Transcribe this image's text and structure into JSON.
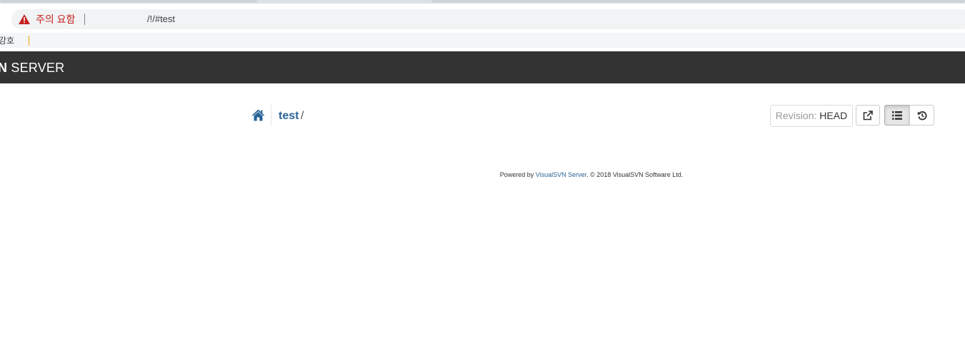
{
  "browser": {
    "back_glyph": "·",
    "security_label": "주의 요함",
    "url": "/!/#test",
    "bookmark_item": "강호"
  },
  "navbar": {
    "brand_bold": "N",
    "brand_rest": " SERVER"
  },
  "breadcrumb": {
    "repo": "test",
    "separator": "/"
  },
  "toolbar": {
    "revision_label": "Revision:",
    "revision_value": "HEAD"
  },
  "footer": {
    "prefix": "Powered by ",
    "link": "VisualSVN Server",
    "suffix": ". © 2018 VisualSVN Software Ltd."
  },
  "colors": {
    "navbar": "#333333",
    "link": "#2a6496",
    "warning": "#c5221f"
  },
  "icons": [
    "warning-icon",
    "home-icon",
    "external-link-icon",
    "list-icon",
    "history-icon"
  ]
}
